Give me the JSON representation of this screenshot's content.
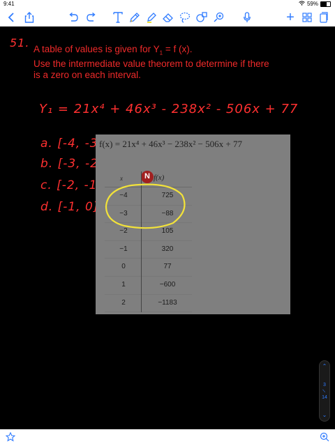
{
  "status_bar": {
    "time": "9:41",
    "battery_percent": "59%",
    "battery_level": 0.59
  },
  "toolbar": {
    "add_label": "+"
  },
  "problem": {
    "number": "51.",
    "line1": "A table of values is given for Y",
    "subscript": "1",
    "line1_end": " = f (x).",
    "line2": "Use the intermediate value theorem to determine if there",
    "line3": "is a zero on each interval."
  },
  "handwriting": {
    "equation": "Y₁ = 21x⁴ + 46x³ - 238x² - 506x + 77",
    "intervals": [
      "a. [-4, -3]",
      "b. [-3, -2]",
      "c. [-2, -1]",
      "d. [-1, 0]"
    ]
  },
  "image_overlay": {
    "formula": "f(x) = 21x⁴ + 46x³ − 238x² − 506x + 77",
    "logo_letter": "N",
    "col_x": "x",
    "col_fx": "f(x)",
    "rows": [
      {
        "x": "−4",
        "fx": "725"
      },
      {
        "x": "−3",
        "fx": "−88"
      },
      {
        "x": "−2",
        "fx": "105"
      },
      {
        "x": "−1",
        "fx": "320"
      },
      {
        "x": "0",
        "fx": "77"
      },
      {
        "x": "1",
        "fx": "−600"
      },
      {
        "x": "2",
        "fx": "−1183"
      }
    ]
  },
  "pager": {
    "current": "3",
    "total": "14"
  },
  "colors": {
    "accent": "#2f7bff",
    "ink_red": "#ff3030",
    "highlight_yellow": "#f2e23a"
  }
}
